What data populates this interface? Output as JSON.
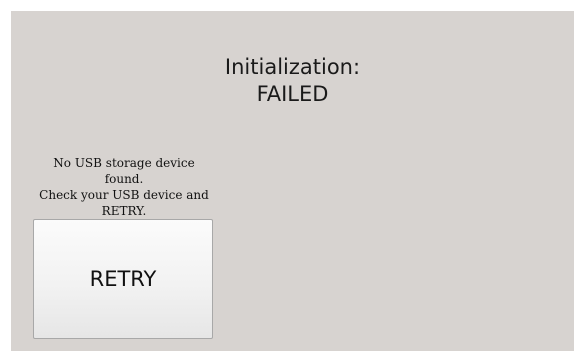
{
  "status": {
    "title_line1": "Initialization:",
    "title_line2": "FAILED"
  },
  "message": {
    "line1": "No USB storage device found.",
    "line2": "Check your USB device and",
    "line3": "RETRY."
  },
  "retry_button": {
    "label": "RETRY"
  },
  "colors": {
    "background": "#d7d3d0",
    "button_face": "#f2f2f2",
    "text": "#111111"
  }
}
